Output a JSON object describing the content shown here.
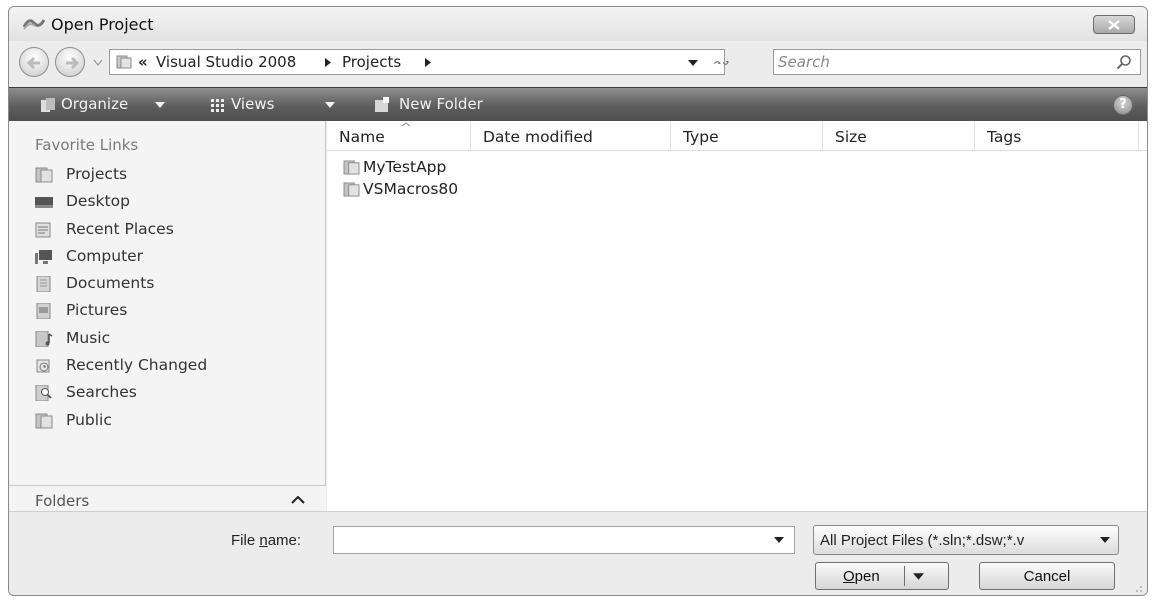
{
  "window": {
    "title": "Open Project"
  },
  "address": {
    "more": "«",
    "crumbs": [
      "Visual Studio 2008",
      "Projects"
    ],
    "search_placeholder": "Search"
  },
  "toolbar": {
    "organize": "Organize",
    "views": "Views",
    "new_folder": "New Folder",
    "help": "?"
  },
  "sidebar": {
    "header": "Favorite Links",
    "items": [
      {
        "label": "Projects",
        "icon": "folder-icon"
      },
      {
        "label": "Desktop",
        "icon": "desktop-icon"
      },
      {
        "label": "Recent Places",
        "icon": "recent-places-icon"
      },
      {
        "label": "Computer",
        "icon": "computer-icon"
      },
      {
        "label": "Documents",
        "icon": "documents-icon"
      },
      {
        "label": "Pictures",
        "icon": "pictures-icon"
      },
      {
        "label": "Music",
        "icon": "music-icon"
      },
      {
        "label": "Recently Changed",
        "icon": "recently-changed-icon"
      },
      {
        "label": "Searches",
        "icon": "searches-icon"
      },
      {
        "label": "Public",
        "icon": "folder-icon"
      }
    ],
    "folders_label": "Folders"
  },
  "filelist": {
    "columns": [
      "Name",
      "Date modified",
      "Type",
      "Size",
      "Tags"
    ],
    "items": [
      {
        "name": "MyTestApp",
        "icon": "folder-icon"
      },
      {
        "name": "VSMacros80",
        "icon": "folder-icon"
      }
    ]
  },
  "footer": {
    "filename_label_pre": "File ",
    "filename_label_u": "n",
    "filename_label_post": "ame:",
    "filename_value": "",
    "filter": "All Project Files (*.sln;*.dsw;*.v",
    "open_u": "O",
    "open_rest": "pen",
    "cancel": "Cancel"
  }
}
